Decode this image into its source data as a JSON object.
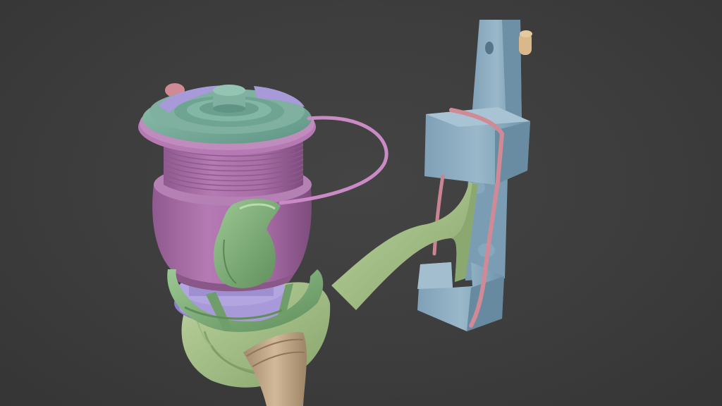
{
  "scene": {
    "subject": "spinning-reel-model",
    "colors": {
      "background": "#3d3d3d",
      "spool": "#b57ab3",
      "spool_dark": "#9a5f98",
      "cap": "#7fb0a0",
      "cap_dark": "#5f9484",
      "body": "#a9c38c",
      "body_dark": "#8aa870",
      "rotor": "#8dbb86",
      "rotor_dark": "#6f9e6a",
      "clamp": "#8fb0c4",
      "clamp_dark": "#6f93aa",
      "band": "#d08a96",
      "lavender": "#a89ad8",
      "handle": "#c9b08e",
      "handle_dark": "#a89070"
    }
  }
}
